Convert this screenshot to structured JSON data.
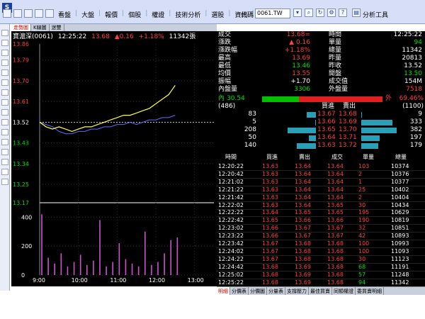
{
  "toolbar": {
    "menu": [
      "看盤",
      "大盤",
      "報價",
      "個股",
      "權證",
      "技術分析",
      "選股",
      "資訊",
      "工具"
    ],
    "code_label": "代碼",
    "code_value": "0061.TW",
    "tools_label": "分析工具"
  },
  "chart": {
    "tabs": [
      "走勢圖",
      "K線圖",
      "迷雙"
    ],
    "header": {
      "name": "寶滬深(0061)",
      "time": "12:25:22",
      "price": "13.68",
      "change": "▲0.16",
      "pct": "+1.18%",
      "volume": "11342張"
    },
    "price_ticks": [
      "13.86",
      "13.79",
      "13.70",
      "13.61",
      "13.52",
      "13.43",
      "13.34",
      "13.25",
      "13.17"
    ],
    "volume_ticks": [
      "400",
      "200",
      "0"
    ],
    "time_ticks": [
      "9:00",
      "10:00",
      "11:00",
      "12:00",
      "13:00"
    ],
    "colors": {
      "price_line": "#ffff40",
      "avg_line": "#5a6cff",
      "volume_bars": "#d050d0",
      "ref_line": "#ffffff"
    }
  },
  "chart_data": {
    "type": "line",
    "title": "寶滬深(0061)",
    "x": [
      "9:00",
      "9:10",
      "9:20",
      "9:30",
      "9:40",
      "9:50",
      "10:00",
      "10:10",
      "10:20",
      "10:30",
      "10:40",
      "10:50",
      "11:00",
      "11:10",
      "11:20",
      "11:30",
      "11:40",
      "11:50",
      "12:00",
      "12:10",
      "12:20",
      "12:25"
    ],
    "series": [
      {
        "values": [
          13.52,
          13.5,
          13.49,
          13.5,
          13.49,
          13.48,
          13.49,
          13.5,
          13.5,
          13.51,
          13.52,
          13.53,
          13.54,
          13.55,
          13.55,
          13.56,
          13.57,
          13.58,
          13.6,
          13.62,
          13.64,
          13.68
        ]
      },
      {
        "values": [
          13.52,
          13.51,
          13.5,
          13.48,
          13.47,
          13.47,
          13.48,
          13.48,
          13.49,
          13.49,
          13.5,
          13.5,
          13.51,
          13.51,
          13.52,
          13.51,
          13.52,
          13.53,
          13.53,
          13.54,
          13.54,
          13.55
        ]
      }
    ],
    "volume": [
      420,
      120,
      80,
      150,
      60,
      90,
      140,
      70,
      100,
      380,
      60,
      90,
      220,
      110,
      80,
      60,
      300,
      70,
      90,
      150,
      240,
      260
    ],
    "ylim": [
      13.17,
      13.86
    ],
    "volume_ylim": [
      0,
      480
    ],
    "reference_price": 13.52
  },
  "quote": {
    "stats_left": [
      {
        "label": "成交",
        "value": "13.68",
        "suffix": "="
      },
      {
        "label": "漲跌",
        "value": "▲ 0.16"
      },
      {
        "label": "漲跌幅",
        "value": "+1.18%"
      },
      {
        "label": "最高",
        "value": "13.69"
      },
      {
        "label": "最低",
        "value": "13.46"
      },
      {
        "label": "均價",
        "value": "13.55"
      },
      {
        "label": "振幅",
        "value": "+1.70"
      },
      {
        "label": "內盤量",
        "value": "3306"
      }
    ],
    "stats_right": [
      {
        "label": "時間",
        "value": "12:25:22"
      },
      {
        "label": "單量",
        "value": "94"
      },
      {
        "label": "總量",
        "value": "11342"
      },
      {
        "label": "昨量",
        "value": "20813"
      },
      {
        "label": "昨收",
        "value": "13.52"
      },
      {
        "label": "開盤",
        "value": "13.50"
      },
      {
        "label": "成交值",
        "value": "154M"
      },
      {
        "label": "外盤量",
        "value": "7518"
      }
    ],
    "ratio": {
      "inner_label": "內",
      "inner_pct": "30.54",
      "outer_label": "外",
      "outer_pct": "69.46%"
    },
    "depth_header": {
      "left_total": "(486)",
      "bid": "買進",
      "ask": "賣出",
      "right_total": "(1100)"
    },
    "depth": [
      {
        "bid_vol": "83",
        "bid": "13.67",
        "ask": "13.68",
        "ask_vol": "9",
        "bid_frac": 0.17,
        "ask_frac": 0.02
      },
      {
        "bid_vol": "5",
        "bid": "13.66",
        "ask": "13.69",
        "ask_vol": "333",
        "bid_frac": 0.01,
        "ask_frac": 0.87
      },
      {
        "bid_vol": "208",
        "bid": "13.65",
        "ask": "13.70",
        "ask_vol": "382",
        "bid_frac": 0.54,
        "ask_frac": 1.0
      },
      {
        "bid_vol": "50",
        "bid": "13.64",
        "ask": "13.71",
        "ask_vol": "197",
        "bid_frac": 0.13,
        "ask_frac": 0.52
      },
      {
        "bid_vol": "140",
        "bid": "13.63",
        "ask": "13.72",
        "ask_vol": "179",
        "bid_frac": 0.37,
        "ask_frac": 0.47
      }
    ],
    "trades_header": [
      "時間",
      "買進",
      "賣出",
      "成交",
      "單量",
      "總量"
    ],
    "trades": [
      [
        "12:20:22",
        "13.63",
        "13.64",
        "13.64",
        "103",
        "10374"
      ],
      [
        "12:20:42",
        "13.63",
        "13.64",
        "13.64",
        "2",
        "10376"
      ],
      [
        "12:21:02",
        "13.63",
        "13.64",
        "13.64",
        "1",
        "10377"
      ],
      [
        "12:21:22",
        "13.63",
        "13.64",
        "13.64",
        "25",
        "10402"
      ],
      [
        "12:21:42",
        "13.63",
        "13.64",
        "13.64",
        "2",
        "10404"
      ],
      [
        "12:22:02",
        "13.63",
        "13.64",
        "13.65",
        "30",
        "10434"
      ],
      [
        "12:22:22",
        "13.64",
        "13.65",
        "13.65",
        "195",
        "10629"
      ],
      [
        "12:22:42",
        "13.65",
        "13.66",
        "13.66",
        "190",
        "10819"
      ],
      [
        "12:23:02",
        "13.66",
        "13.67",
        "13.67",
        "32",
        "10851"
      ],
      [
        "12:23:22",
        "13.66",
        "13.67",
        "13.67",
        "42",
        "10893"
      ],
      [
        "12:23:42",
        "13.67",
        "13.68",
        "13.68",
        "100",
        "10993"
      ],
      [
        "12:24:02",
        "13.67",
        "13.68",
        "13.68",
        "100",
        "11093"
      ],
      [
        "12:24:22",
        "13.67",
        "13.68",
        "13.68",
        "30",
        "11123"
      ],
      [
        "12:24:42",
        "13.68",
        "13.69",
        "13.68",
        "68",
        "11191"
      ],
      [
        "12:25:02",
        "13.68",
        "13.69",
        "13.68",
        "57",
        "11248"
      ],
      [
        "12:25:22",
        "13.68",
        "13.69",
        "13.68",
        "94",
        "11342"
      ]
    ]
  },
  "bottom_tabs": [
    "明細",
    "分價表",
    "分價圖",
    "分量表",
    "支撐壓力",
    "最佳買賣",
    "同類權證",
    "委買賣明細"
  ]
}
